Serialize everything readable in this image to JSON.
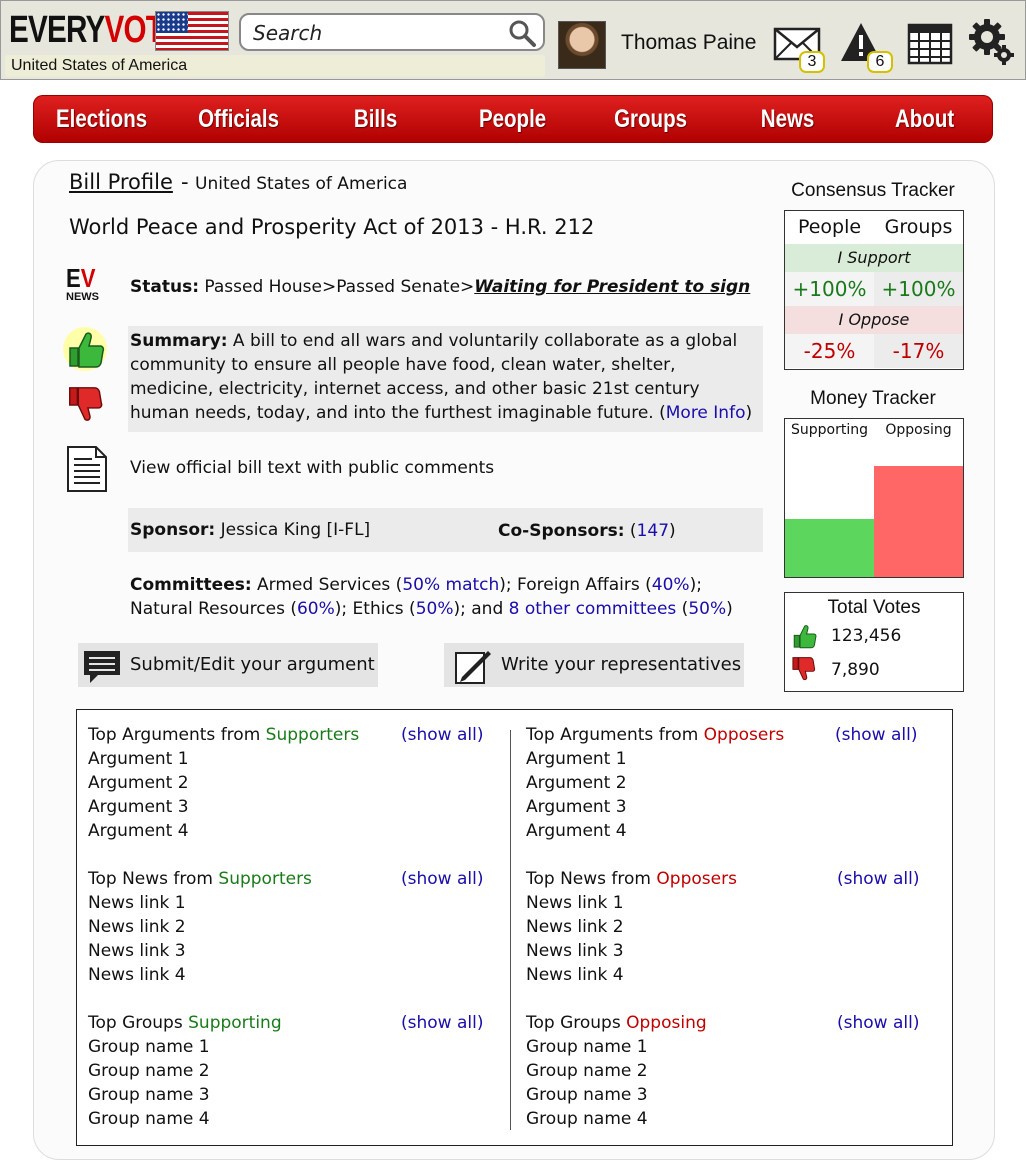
{
  "header": {
    "logo_part1": "EVERY",
    "logo_part2": "VOTE",
    "country": "United States of America",
    "search_placeholder": "Search",
    "user_name": "Thomas Paine",
    "messages_count": "3",
    "alerts_count": "6"
  },
  "nav": [
    "Elections",
    "Officials",
    "Bills",
    "People",
    "Groups",
    "News",
    "About"
  ],
  "bill": {
    "profile_label": "Bill Profile",
    "dash": "-",
    "country": "United States of America",
    "name": "World Peace and Prosperity Act of 2013 - H.R. 212",
    "ev_icon_text": "EV",
    "ev_icon_sub": "NEWS",
    "status_label": "Status:",
    "status_steps": "Passed House>Passed Senate>",
    "status_current": "Waiting for President to sign",
    "summary_label": "Summary:",
    "summary_text": "A bill to end all wars and voluntarily collaborate as a global community to ensure all people have food, clean water, shelter, medicine, electricity, internet access, and other basic 21st century human needs, today, and into the furthest imaginable future.",
    "more_info": "More Info",
    "bill_text_link": "View official bill text with public comments",
    "sponsor_label": "Sponsor:",
    "sponsor_name": "Jessica King [I-FL]",
    "cosponsors_label": "Co-Sponsors:",
    "cosponsors_count": "147",
    "committees_label": "Committees:",
    "committees": {
      "c1": "Armed Services",
      "c1_match": "50% match",
      "c2": "Foreign Affairs",
      "c2_match": "40%",
      "c3": "Natural Resources",
      "c3_match": "60%",
      "c4": "Ethics",
      "c4_match": "50%",
      "other": "8 other committees",
      "other_match": "50%"
    },
    "argument_button": "Submit/Edit your argument",
    "write_button": "Write your representatives"
  },
  "consensus": {
    "title": "Consensus Tracker",
    "col_people": "People",
    "col_groups": "Groups",
    "support_label": "I Support",
    "support_people": "+100%",
    "support_groups": "+100%",
    "oppose_label": "I Oppose",
    "oppose_people": "-25%",
    "oppose_groups": "-17%"
  },
  "money": {
    "title": "Money Tracker",
    "supporting_label": "Supporting",
    "opposing_label": "Opposing",
    "supporting_level": 0.37,
    "opposing_level": 0.7,
    "supporting_color": "#5cd65c",
    "opposing_color": "#ff6666"
  },
  "totals": {
    "title": "Total Votes",
    "up": "123,456",
    "down": "7,890"
  },
  "lists": {
    "show_all": "(show all)",
    "args_sup_prefix": "Top Arguments from",
    "args_sup_word": "Supporters",
    "args_opp_prefix": "Top Arguments from",
    "args_opp_word": "Opposers",
    "news_sup_prefix": "Top News from",
    "news_sup_word": "Supporters",
    "news_opp_prefix": "Top News from",
    "news_opp_word": "Opposers",
    "groups_sup_prefix": "Top Groups",
    "groups_sup_word": "Supporting",
    "groups_opp_prefix": "Top Groups",
    "groups_opp_word": "Opposing",
    "arguments": [
      "Argument 1",
      "Argument 2",
      "Argument 3",
      "Argument 4"
    ],
    "news": [
      "News link 1",
      "News link 2",
      "News link 3",
      "News link 4"
    ],
    "groups": [
      "Group name 1",
      "Group name 2",
      "Group name 3",
      "Group name 4"
    ]
  }
}
